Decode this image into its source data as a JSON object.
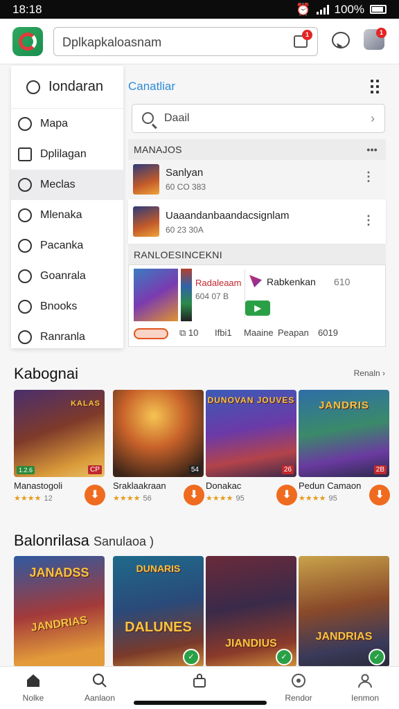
{
  "status_bar": {
    "time": "18:18",
    "battery": "100%"
  },
  "topbar": {
    "search_text": "Dplkapkaloasnam",
    "notif_count": "1",
    "profile_count": "1"
  },
  "sidebar": {
    "title": "Iondaran",
    "items": [
      {
        "label": "Mapa"
      },
      {
        "label": "Dplilagan"
      },
      {
        "label": "Meclas"
      },
      {
        "label": "Mlenaka"
      },
      {
        "label": "Pacanka"
      },
      {
        "label": "Goanrala"
      },
      {
        "label": "Bnooks"
      },
      {
        "label": "Ranranla"
      }
    ]
  },
  "content": {
    "title": "Canatliar",
    "search_text": "Daail",
    "section1": "MANAJOS",
    "list": [
      {
        "name": "Sanlyan",
        "sub": "60 CO 383"
      },
      {
        "name": "Uaaandanbaandacsignlam",
        "sub": "60 23 30A"
      }
    ],
    "section2": "RANLOESINCEKNI",
    "featured": {
      "title": "Radaleaam",
      "sub": "604 07 B",
      "name": "Rabkenkan",
      "num": "610",
      "play": "▶",
      "meta": [
        "⧉ 10",
        "Ifbi1",
        "Maaine",
        "Peapan",
        "6019"
      ]
    }
  },
  "section_kat": {
    "title": "Kabognai",
    "see_all": "Renaln ›"
  },
  "cards": [
    {
      "name": "Manastogoli",
      "rating": "12",
      "band": "KALAS",
      "tag": "CP",
      "tagl": "1.2.6"
    },
    {
      "name": "Sraklaakraan",
      "rating": "56",
      "band": "",
      "tag": "54",
      "tagl": ""
    },
    {
      "name": "Donakac",
      "rating": "95",
      "band": "DUNOVAN JOUVES",
      "tag": "26",
      "tagl": ""
    },
    {
      "name": "Pedun Camaon",
      "rating": "95",
      "band": "JANDRIS",
      "tag": "2B",
      "tagl": ""
    }
  ],
  "section_bal": {
    "title": "Balonrilasa",
    "subtitle": "Sanulaoa )"
  },
  "cards2": [
    {
      "band": "JANADSS",
      "band2": "JANDRIAS"
    },
    {
      "band": "DUNARIS",
      "band2": "DALUNES"
    },
    {
      "band": "",
      "band2": "JIANDIUS"
    },
    {
      "band": "",
      "band2": "JANDRIAS"
    }
  ],
  "tabs": [
    {
      "label": "Nolke"
    },
    {
      "label": "Aanlaon"
    },
    {
      "label": ""
    },
    {
      "label": "Rendor"
    },
    {
      "label": "Ienmon"
    }
  ]
}
